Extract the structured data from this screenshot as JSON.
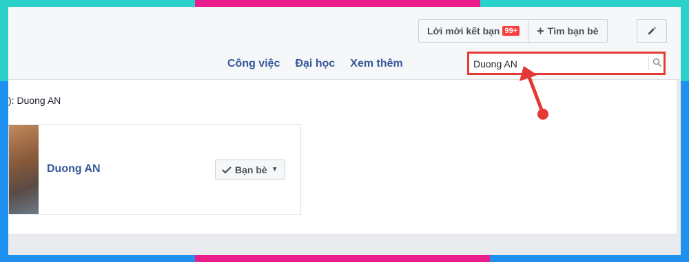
{
  "header": {
    "friend_requests_label": "Lời mời kết bạn",
    "friend_requests_badge": "99+",
    "find_friends_label": "Tìm bạn bè"
  },
  "nav": {
    "items": [
      "Công việc",
      "Đại học",
      "Xem thêm"
    ]
  },
  "search": {
    "value": "Duong AN"
  },
  "results": {
    "label_fragment": "): Duong AN",
    "card": {
      "name": "Duong AN",
      "friend_button_label": "Bạn bè"
    }
  },
  "colors": {
    "link": "#365899",
    "highlight": "#e53935",
    "badge": "#fa3e3e"
  }
}
